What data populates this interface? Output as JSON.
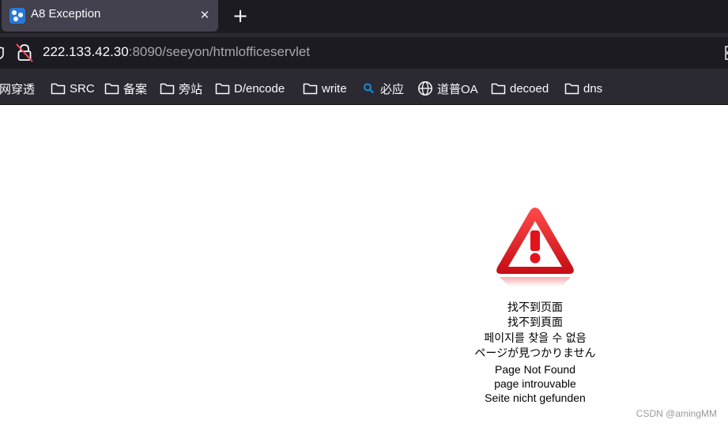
{
  "tab": {
    "title": "A8 Exception",
    "close_glyph": "✕",
    "favicon": "seeyon-favicon"
  },
  "newtab": {
    "glyph": "+"
  },
  "address": {
    "host": "222.133.42.30",
    "rest": ":8090/seeyon/htmlofficeservlet"
  },
  "bookmarks": [
    {
      "label": "内网穿透",
      "icon": "folder-icon"
    },
    {
      "label": "SRC",
      "icon": "folder-icon"
    },
    {
      "label": "备案",
      "icon": "folder-icon"
    },
    {
      "label": "旁站",
      "icon": "folder-icon"
    },
    {
      "label": "D/encode",
      "icon": "folder-icon"
    },
    {
      "label": "write",
      "icon": "folder-icon"
    },
    {
      "label": "必应",
      "icon": "search-icon"
    },
    {
      "label": "道普OA",
      "icon": "globe-icon"
    },
    {
      "label": "decoed",
      "icon": "folder-icon"
    },
    {
      "label": "dns",
      "icon": "folder-icon"
    }
  ],
  "error": {
    "icon": "warning-triangle-icon",
    "messages": [
      "找不到页面",
      "找不到頁面",
      "페이지를 찾을 수 없음",
      "ページが見つかりません",
      "Page Not Found",
      "page introuvable",
      "Seite nicht gefunden"
    ]
  },
  "watermark": "CSDN @amingMM",
  "colors": {
    "chrome_dark": "#1c1b22",
    "chrome": "#2b2a33",
    "tab_active": "#42414d",
    "warning_red": "#e2131d"
  }
}
